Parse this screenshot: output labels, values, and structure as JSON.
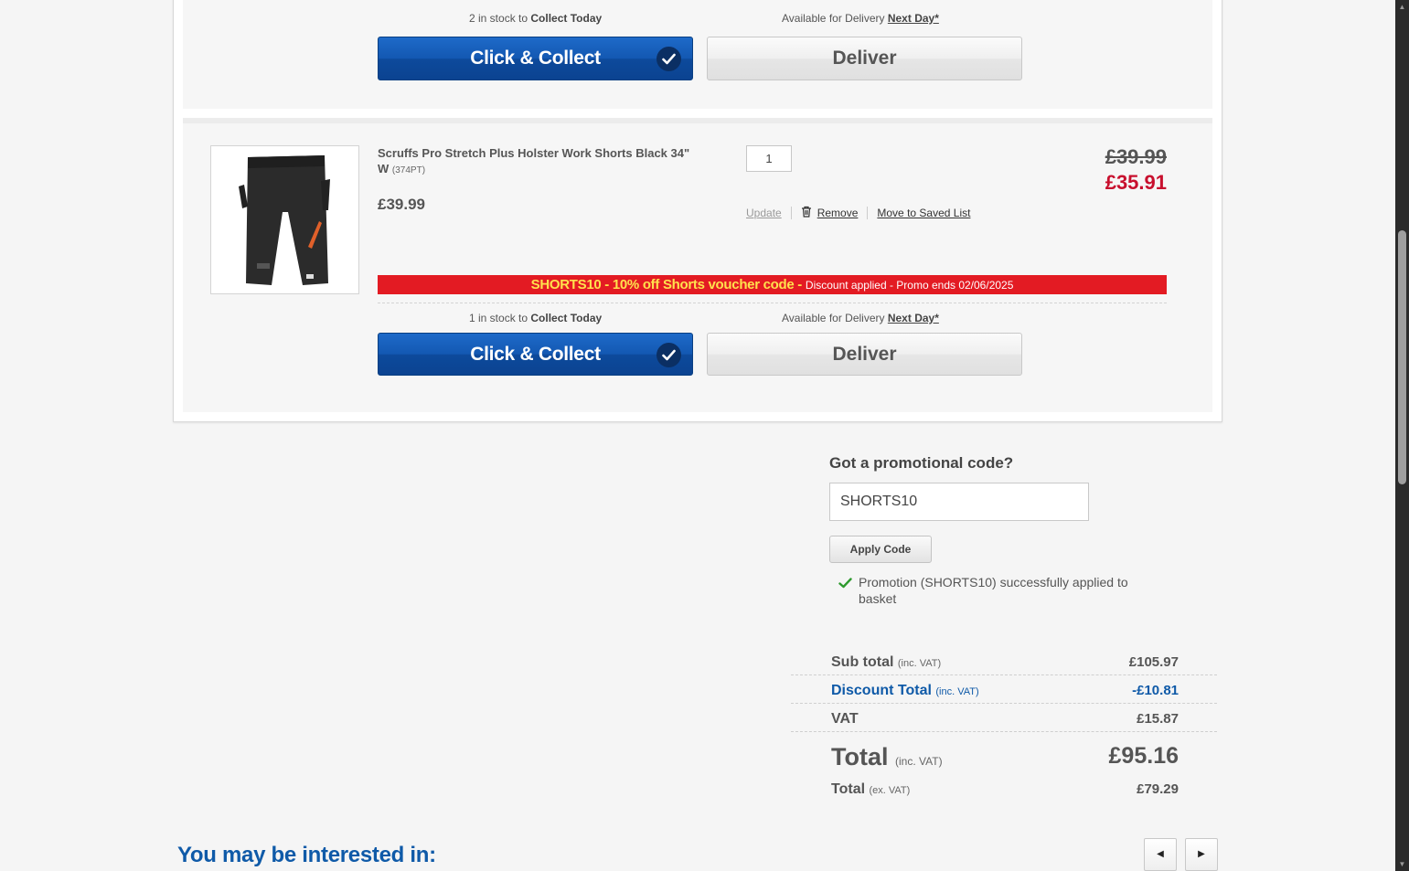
{
  "item1": {
    "stock_prefix": "2 in stock to",
    "stock_bold": "Collect Today",
    "delivery_prefix": "Available for Delivery",
    "delivery_bold": "Next Day*",
    "collect_label": "Click & Collect",
    "deliver_label": "Deliver"
  },
  "item2": {
    "name": "Scruffs Pro Stretch Plus Holster Work Shorts Black 34\" W",
    "sku": "(374PT)",
    "unit_price": "£39.99",
    "quantity": "1",
    "update_label": "Update",
    "remove_label": "Remove",
    "save_label": "Move to Saved List",
    "old_price": "£39.99",
    "new_price": "£35.91",
    "promo_code_text": "SHORTS10 - 10% off Shorts voucher code -",
    "promo_rest_text": "Discount applied - Promo ends 02/06/2025",
    "stock_prefix": "1 in stock to",
    "stock_bold": "Collect Today",
    "delivery_prefix": "Available for Delivery",
    "delivery_bold": "Next Day*",
    "collect_label": "Click & Collect",
    "deliver_label": "Deliver"
  },
  "promo": {
    "heading": "Got a promotional code?",
    "input_value": "SHORTS10",
    "apply_label": "Apply Code",
    "success_message": "Promotion (SHORTS10) successfully applied to basket"
  },
  "totals": {
    "subtotal_label": "Sub total",
    "subtotal_suffix": "(inc. VAT)",
    "subtotal_value": "£105.97",
    "discount_label": "Discount Total",
    "discount_suffix": "(inc. VAT)",
    "discount_value": "-£10.81",
    "vat_label": "VAT",
    "vat_value": "£15.87",
    "total_label": "Total",
    "total_suffix": "(inc. VAT)",
    "total_value": "£95.16",
    "total_ex_label": "Total",
    "total_ex_suffix": "(ex. VAT)",
    "total_ex_value": "£79.29"
  },
  "recommendations": {
    "heading": "You may be interested in:"
  },
  "colors": {
    "brand_blue": "#0f5aa8",
    "sale_red": "#c8102e",
    "promo_banner": "#e31b23",
    "promo_yellow": "#ffe14d"
  },
  "icons": [
    "check-circle-icon",
    "trash-icon",
    "success-check-icon",
    "chevron-left-icon",
    "chevron-right-icon"
  ]
}
